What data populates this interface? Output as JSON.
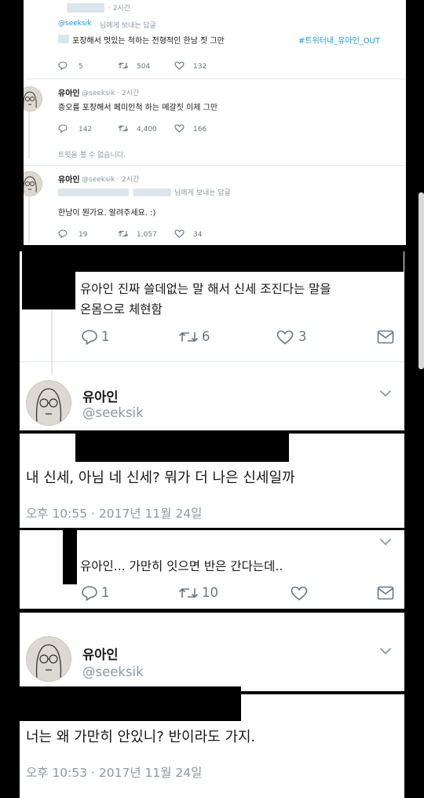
{
  "colors": {
    "link": "#1b95e0",
    "muted": "#8899a6",
    "divider": "#e1e8ed",
    "censor": "#000000"
  },
  "tweet1": {
    "time": "· 2시간",
    "reply_prefix": "@seeksik",
    "reply_suffix": "님에게 보내는 답글",
    "text": "포장해서 멋있는 척하는 전형적인 한남 짓 그만",
    "hashtag": "#트위터내_유아인_OUT",
    "actions": {
      "replies": "5",
      "retweets": "504",
      "likes": "132"
    }
  },
  "tweet2": {
    "name": "유아인",
    "handle": "@seeksik · 2시간",
    "text": "증오를 포장해서 페미인척 하는 메갈짓 이제 그만",
    "actions": {
      "replies": "142",
      "retweets": "4,400",
      "likes": "166"
    }
  },
  "unavailable": "트윗을 볼 수 없습니다.",
  "tweet3": {
    "name": "유아인",
    "handle": "@seeksik · 2시간",
    "reply_suffix": "님에게 보내는 답글",
    "text": "한남이 뭔가요. 알려주세요. :)",
    "actions": {
      "replies": "19",
      "retweets": "1,057",
      "likes": "34"
    }
  },
  "reply1": {
    "text_line1": "유아인 진짜 쓸데없는 말 해서 신세 조진다는 말을",
    "text_line2": "온몸으로 체현함",
    "actions": {
      "replies": "1",
      "retweets": "6",
      "likes": "3"
    }
  },
  "main1": {
    "name": "유아인",
    "handle": "@seeksik",
    "text": "내 신세, 아님 네 신세? 뭐가 더 나은 신세일까",
    "timestamp": "오후 10:55 · 2017년 11월 24일"
  },
  "reply2": {
    "text": "유아인... 가만히 잇으면 반은 간다는데..",
    "actions": {
      "replies": "1",
      "retweets": "10"
    }
  },
  "main2": {
    "name": "유아인",
    "handle": "@seeksik",
    "text": "너는 왜 가만히 안있니? 반이라도 가지.",
    "timestamp": "오후 10:53 · 2017년 11월 24일"
  }
}
